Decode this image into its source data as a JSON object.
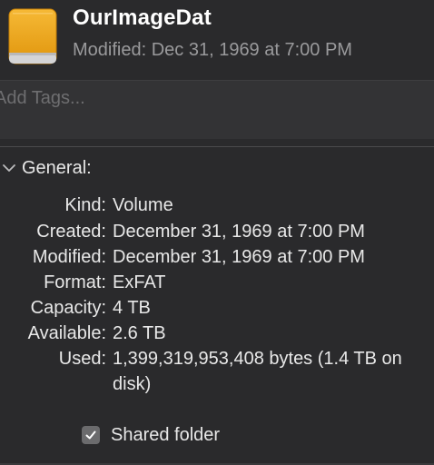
{
  "header": {
    "title": "OurImageDat",
    "subtitle": "Modified: Dec 31, 1969 at 7:00 PM"
  },
  "tags": {
    "placeholder": "Add Tags...",
    "value": ""
  },
  "general": {
    "title": "General:",
    "expanded": true,
    "rows": [
      {
        "label": "Kind:",
        "value": "Volume"
      },
      {
        "label": "Created:",
        "value": "December 31, 1969 at 7:00 PM"
      },
      {
        "label": "Modified:",
        "value": "December 31, 1969 at 7:00 PM"
      },
      {
        "label": "Format:",
        "value": "ExFAT"
      },
      {
        "label": "Capacity:",
        "value": "4 TB"
      },
      {
        "label": "Available:",
        "value": "2.6 TB"
      },
      {
        "label": "Used:",
        "value": "1,399,319,953,408 bytes (1.4 TB on disk)"
      }
    ],
    "shared_folder": {
      "label": "Shared folder",
      "checked": true
    }
  },
  "colors": {
    "background": "#2a2a2c",
    "drive_orange": "#f0a820",
    "subtitle_gray": "#9a9a9c"
  },
  "icons": {
    "drive": "external-drive-icon",
    "chevron": "chevron-down-icon",
    "check": "checkmark-icon"
  }
}
